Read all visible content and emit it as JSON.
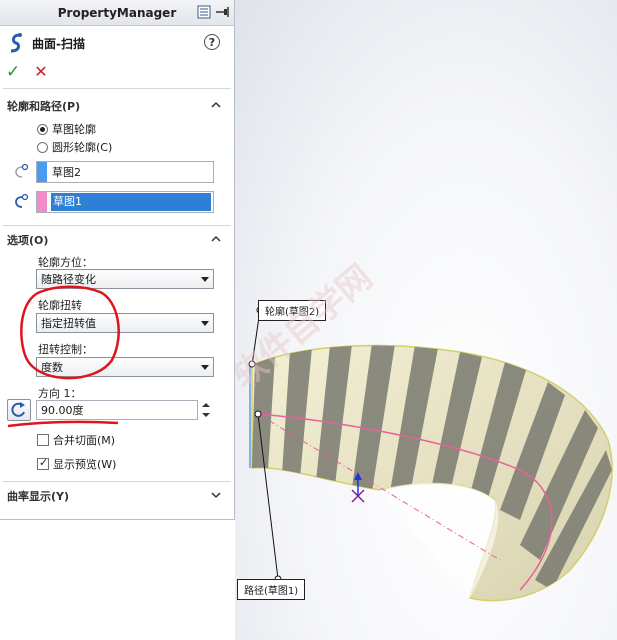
{
  "panel": {
    "title": "PropertyManager",
    "feature_title": "曲面-扫描"
  },
  "profile_section": {
    "header": "轮廓和路径(P)",
    "option_sketch": "草图轮廓",
    "option_circle": "圆形轮廓(C)",
    "profile_value": "草图2",
    "path_value": "草图1",
    "profile_color": "#4a9cf0",
    "path_color": "#f08cc8"
  },
  "options_section": {
    "header": "选项(O)",
    "orientation_label": "轮廓方位：",
    "orientation_value": "随路径变化",
    "twist_label": "轮廓扭转",
    "twist_value": "指定扭转值",
    "twist_control_label": "扭转控制：",
    "twist_control_value": "度数",
    "direction_label": "方向 1：",
    "direction_value": "90.00度",
    "merge_faces_label": "合并切面(M)",
    "show_preview_label": "显示预览(W)"
  },
  "curvature_section": {
    "header": "曲率显示(Y)"
  },
  "viewport": {
    "profile_callout": "轮廓(草图2)",
    "path_callout": "路径(草图1)",
    "watermark": "软件自学网"
  },
  "colors": {
    "accent_selected": "#2f7fd6",
    "annotation_red": "#e0141c",
    "surface": "#ece8c8",
    "path_line": "#e8609c"
  }
}
